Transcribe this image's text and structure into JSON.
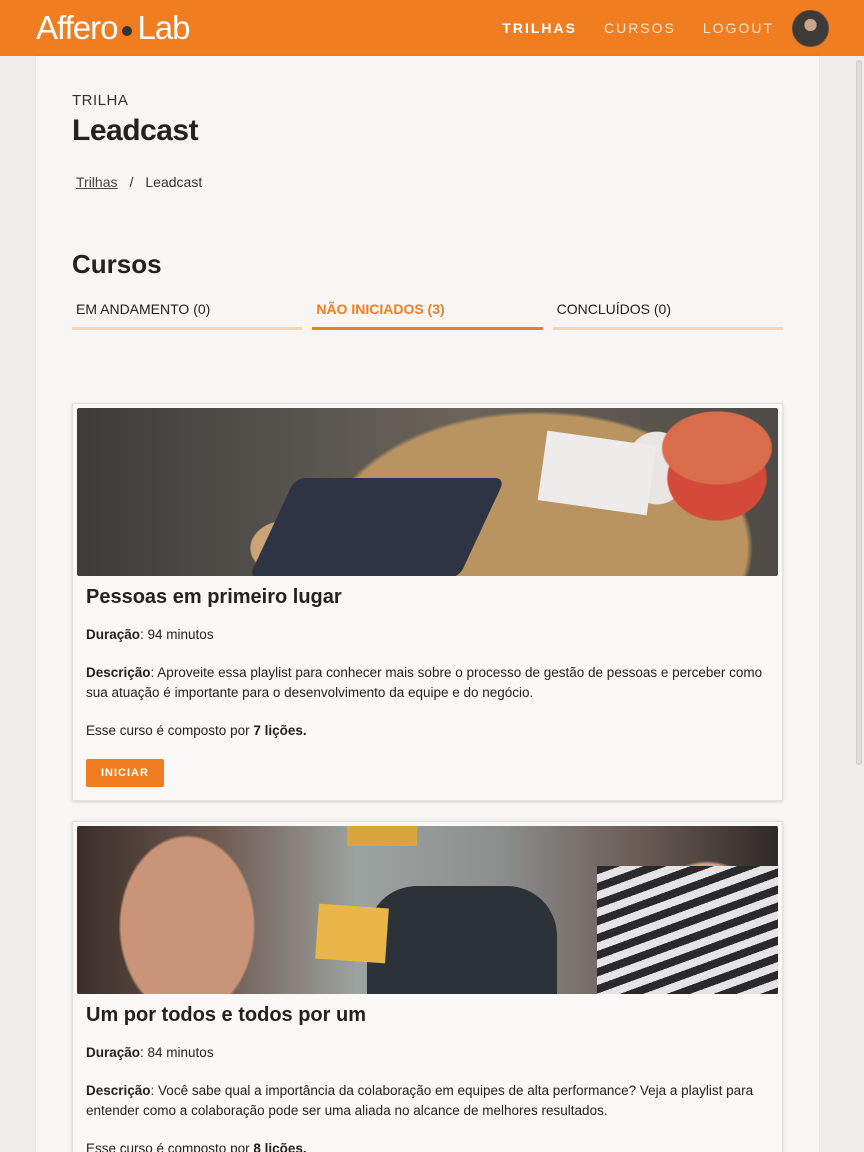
{
  "header": {
    "logo_left": "Affero",
    "logo_right": "Lab",
    "nav": [
      {
        "label": "TRILHAS"
      },
      {
        "label": "CURSOS"
      },
      {
        "label": "LOGOUT"
      }
    ],
    "brand_color": "#f07d1f"
  },
  "page": {
    "eyebrow": "TRILHA",
    "title": "Leadcast",
    "breadcrumb": {
      "link": "Trilhas",
      "separator": "/",
      "current": "Leadcast"
    },
    "section_title": "Cursos",
    "tabs": [
      {
        "label": "EM ANDAMENTO (0)"
      },
      {
        "label": "NÃO INICIADOS (3)"
      },
      {
        "label": "CONCLUÍDOS (0)"
      }
    ]
  },
  "courses": [
    {
      "title": "Pessoas em primeiro lugar",
      "duration_label": "Duração",
      "duration_value": ": 94 minutos",
      "description_label": "Descrição",
      "description_value": ": Aproveite essa playlist para conhecer mais sobre o processo de gestão de pessoas e perceber como sua atuação é importante para o desenvolvimento da equipe e do negócio.",
      "lessons_prefix": "Esse curso é composto por ",
      "lessons_value": "7 lições.",
      "button": "INICIAR"
    },
    {
      "title": "Um por todos e todos por um",
      "duration_label": "Duração",
      "duration_value": ": 84 minutos",
      "description_label": "Descrição",
      "description_value": ": Você sabe qual a importância da colaboração em equipes de alta performance? Veja a playlist para entender como a colaboração pode ser uma aliada no alcance de melhores resultados.",
      "lessons_prefix": "Esse curso é composto por ",
      "lessons_value": "8 lições."
    }
  ]
}
